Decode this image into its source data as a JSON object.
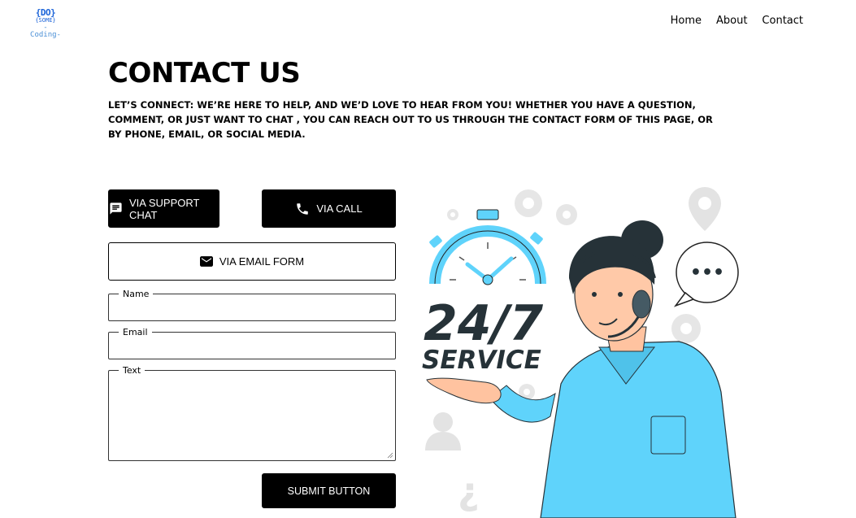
{
  "logo": {
    "line1": "{DO}",
    "line2": "{SOME}",
    "line3": "-Coding-"
  },
  "nav": {
    "items": [
      "Home",
      "About",
      "Contact"
    ]
  },
  "page": {
    "title": "CONTACT US",
    "intro": "LET’S CONNECT: WE’RE HERE TO HELP, AND WE’D LOVE TO HEAR FROM YOU! WHETHER YOU HAVE A QUESTION, COMMENT, OR JUST WANT TO CHAT , YOU CAN REACH OUT TO US THROUGH THE CONTACT FORM OF THIS PAGE, OR BY PHONE, EMAIL, OR SOCIAL MEDIA."
  },
  "contact_buttons": {
    "chat_label": "VIA SUPPORT CHAT",
    "call_label": "VIA CALL",
    "email_label": "VIA EMAIL FORM"
  },
  "form": {
    "name_label": "Name",
    "email_label": "Email",
    "text_label": "Text",
    "name_value": "",
    "email_value": "",
    "text_value": "",
    "submit_label": "SUBMIT BUTTON"
  },
  "illustration": {
    "badge_number": "24/7",
    "badge_word": "SERVICE",
    "chat_dots": "•••"
  },
  "colors": {
    "accent": "#5fd3fb",
    "dark": "#000000",
    "figure_hair": "#263238"
  }
}
